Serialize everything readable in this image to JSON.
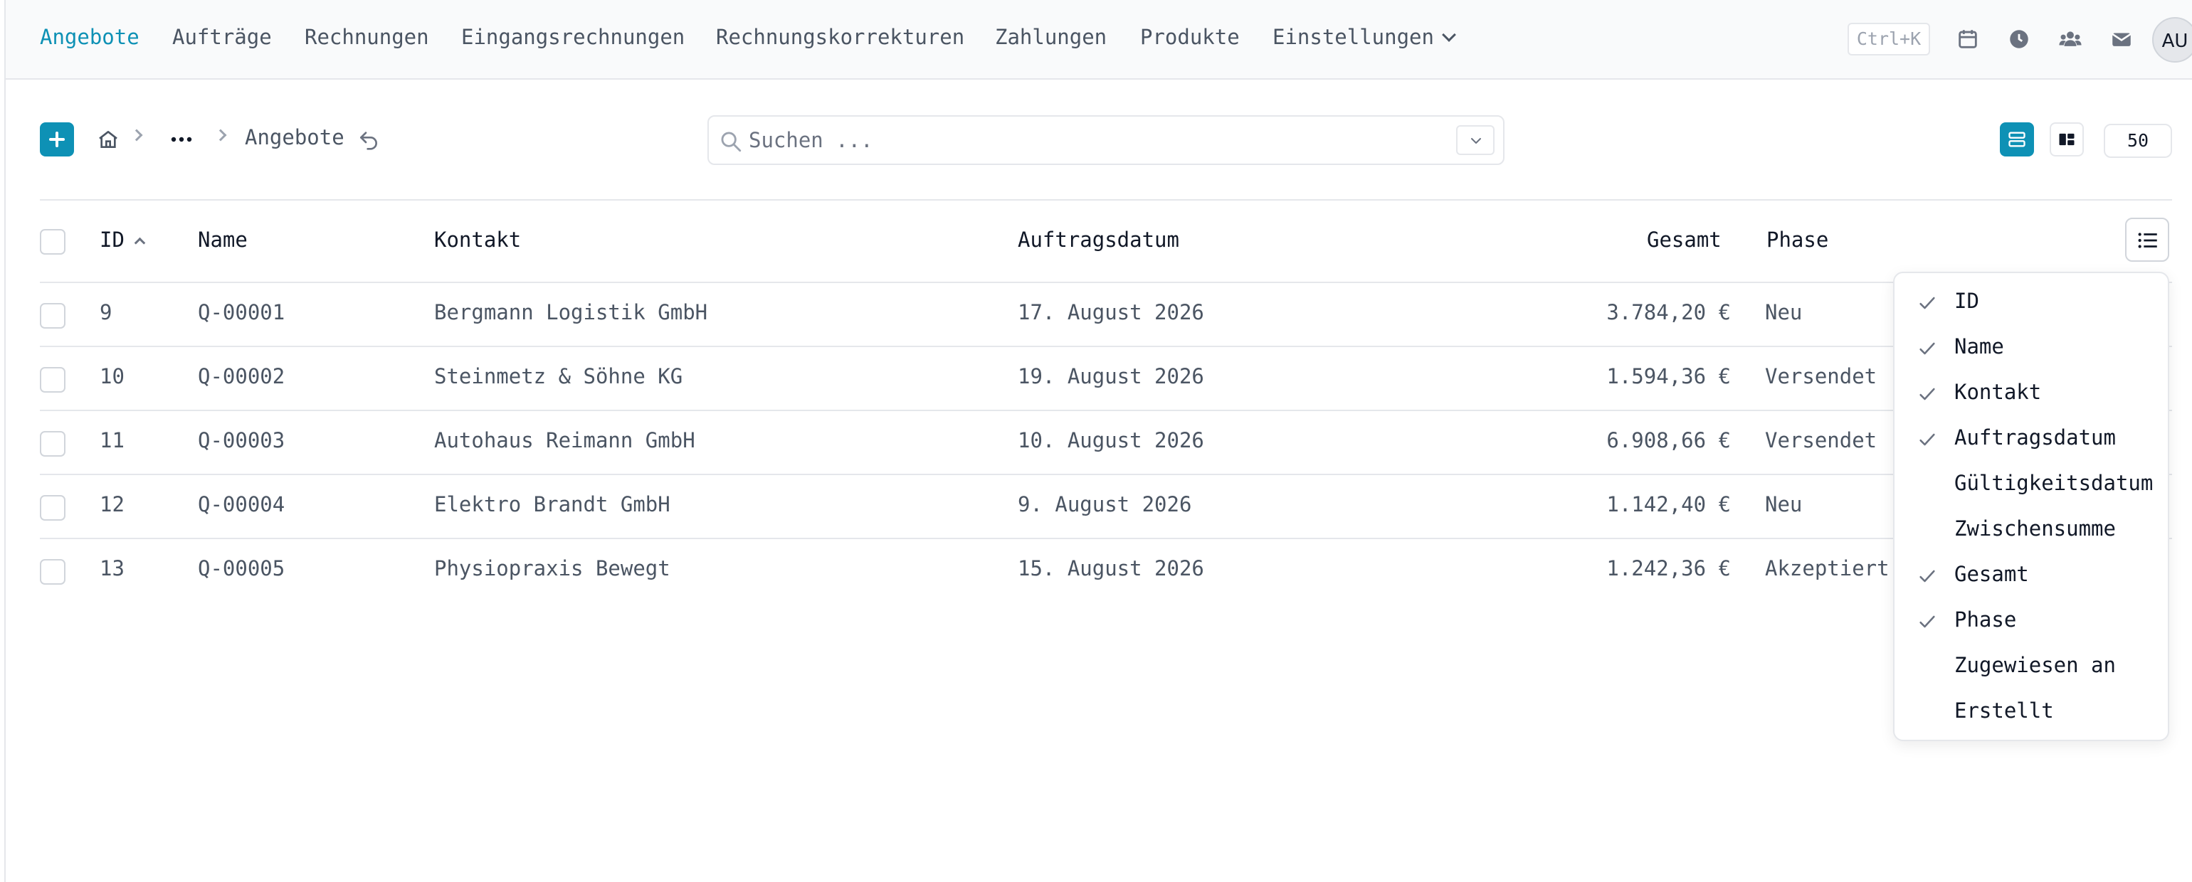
{
  "nav": {
    "items": [
      {
        "label": "Angebote",
        "active": true
      },
      {
        "label": "Aufträge"
      },
      {
        "label": "Rechnungen"
      },
      {
        "label": "Eingangsrechnungen"
      },
      {
        "label": "Rechnungskorrekturen"
      },
      {
        "label": "Zahlungen"
      },
      {
        "label": "Produkte"
      },
      {
        "label": "Einstellungen",
        "has_dropdown": true
      }
    ],
    "shortcut": "Ctrl+K",
    "icons": [
      "calendar-icon",
      "clock-icon",
      "users-icon",
      "mail-icon"
    ],
    "avatar_initials": "AU"
  },
  "toolbar": {
    "breadcrumb_current": "Angebote",
    "search_placeholder": "Suchen ...",
    "page_size": "50"
  },
  "table": {
    "columns": [
      "ID",
      "Name",
      "Kontakt",
      "Auftragsdatum",
      "Gesamt",
      "Phase"
    ],
    "sort": {
      "column": "ID",
      "direction": "ascending"
    },
    "rows": [
      {
        "id": "9",
        "name": "Q-00001",
        "kontakt": "Bergmann Logistik GmbH",
        "datum": "17. August 2026",
        "gesamt": "3.784,20 €",
        "phase": "Neu"
      },
      {
        "id": "10",
        "name": "Q-00002",
        "kontakt": "Steinmetz & Söhne KG",
        "datum": "19. August 2026",
        "gesamt": "1.594,36 €",
        "phase": "Versendet"
      },
      {
        "id": "11",
        "name": "Q-00003",
        "kontakt": "Autohaus Reimann GmbH",
        "datum": "10. August 2026",
        "gesamt": "6.908,66 €",
        "phase": "Versendet"
      },
      {
        "id": "12",
        "name": "Q-00004",
        "kontakt": "Elektro Brandt GmbH",
        "datum": "9. August 2026",
        "gesamt": "1.142,40 €",
        "phase": "Neu"
      },
      {
        "id": "13",
        "name": "Q-00005",
        "kontakt": "Physiopraxis Bewegt",
        "datum": "15. August 2026",
        "gesamt": "1.242,36 €",
        "phase": "Akzeptiert"
      }
    ]
  },
  "column_menu": {
    "items": [
      {
        "label": "ID",
        "checked": true
      },
      {
        "label": "Name",
        "checked": true
      },
      {
        "label": "Kontakt",
        "checked": true
      },
      {
        "label": "Auftragsdatum",
        "checked": true
      },
      {
        "label": "Gültigkeitsdatum",
        "checked": false
      },
      {
        "label": "Zwischensumme",
        "checked": false
      },
      {
        "label": "Gesamt",
        "checked": true
      },
      {
        "label": "Phase",
        "checked": true
      },
      {
        "label": "Zugewiesen an",
        "checked": false
      },
      {
        "label": "Erstellt",
        "checked": false
      }
    ]
  },
  "colors": {
    "accent": "#0e91b5",
    "text": "#4b5563",
    "border": "#e5e7eb"
  }
}
